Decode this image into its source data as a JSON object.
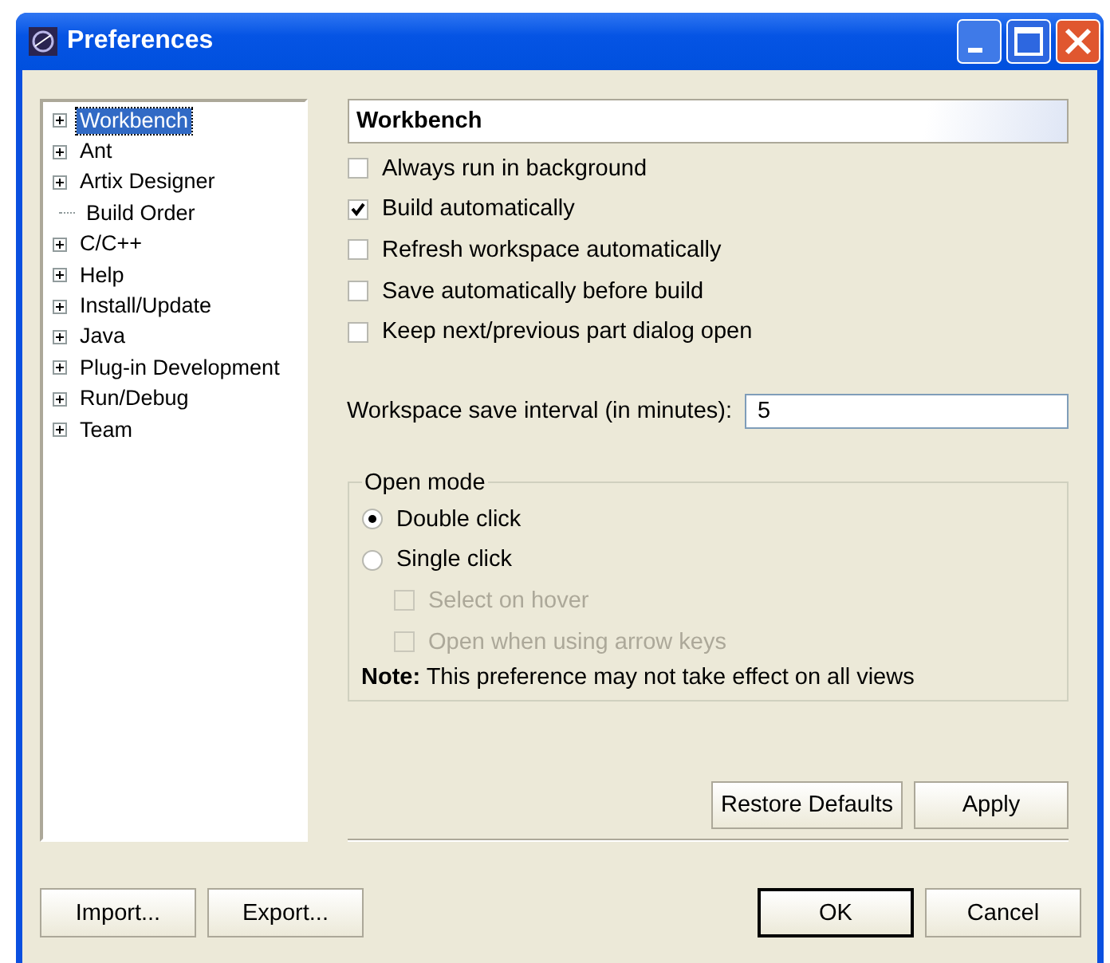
{
  "window": {
    "title": "Preferences"
  },
  "tree": [
    {
      "label": "Workbench",
      "expandable": true,
      "selected": true
    },
    {
      "label": "Ant",
      "expandable": true,
      "selected": false
    },
    {
      "label": "Artix Designer",
      "expandable": true,
      "selected": false
    },
    {
      "label": "Build Order",
      "expandable": false,
      "selected": false
    },
    {
      "label": "C/C++",
      "expandable": true,
      "selected": false
    },
    {
      "label": "Help",
      "expandable": true,
      "selected": false
    },
    {
      "label": "Install/Update",
      "expandable": true,
      "selected": false
    },
    {
      "label": "Java",
      "expandable": true,
      "selected": false
    },
    {
      "label": "Plug-in Development",
      "expandable": true,
      "selected": false
    },
    {
      "label": "Run/Debug",
      "expandable": true,
      "selected": false
    },
    {
      "label": "Team",
      "expandable": true,
      "selected": false
    }
  ],
  "page": {
    "title": "Workbench",
    "options": [
      {
        "label": "Always run in background",
        "checked": false
      },
      {
        "label": "Build automatically",
        "checked": true
      },
      {
        "label": "Refresh workspace automatically",
        "checked": false
      },
      {
        "label": "Save automatically before build",
        "checked": false
      },
      {
        "label": "Keep next/previous part dialog open",
        "checked": false
      }
    ],
    "interval": {
      "label": "Workspace save interval (in minutes):",
      "value": "5"
    },
    "open_mode": {
      "title": "Open mode",
      "radios": [
        {
          "label": "Double click",
          "selected": true
        },
        {
          "label": "Single click",
          "selected": false
        }
      ],
      "suboptions": [
        {
          "label": "Select on hover",
          "checked": false,
          "disabled": true
        },
        {
          "label": "Open when using arrow keys",
          "checked": false,
          "disabled": true
        }
      ],
      "note": "**Note:** This preference may not take effect on all views"
    },
    "buttons": [
      {
        "label": "Restore Defaults",
        "default": false
      },
      {
        "label": "Apply",
        "default": false
      }
    ]
  },
  "footer": {
    "left": [
      {
        "label": "Import...",
        "default": false
      },
      {
        "label": "Export...",
        "default": false
      }
    ],
    "right": [
      {
        "label": "OK",
        "default": true
      },
      {
        "label": "Cancel",
        "default": false
      }
    ]
  }
}
